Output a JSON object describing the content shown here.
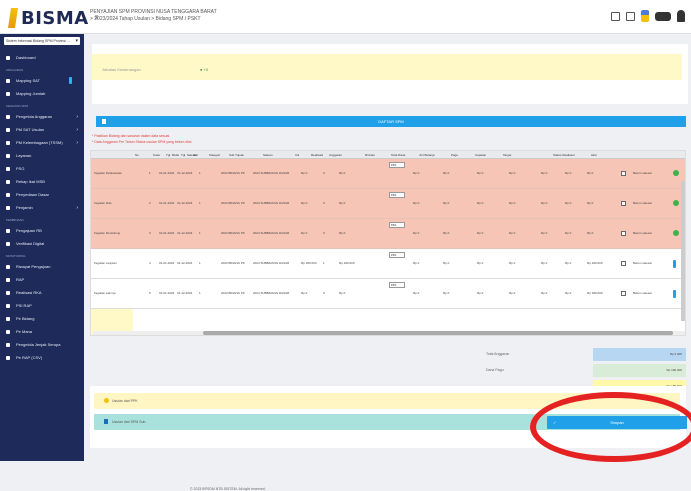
{
  "header": {
    "logo_text": "BISMA",
    "logo_sub": "≡",
    "title_line1": "PENYAJIAN SPM PROVINSI NUSA TENGGARA BARAT",
    "title_line2": "> 2023/2024 Tahap Usulan > Bidang SPM / PSKT"
  },
  "sidebar": {
    "select": "Sistem Informasi Bidang SPM Provinsi ...",
    "items": [
      {
        "label": "Dashboard",
        "group": ""
      },
      {
        "label": "Mapping SAT",
        "group": "ANGGARAN"
      },
      {
        "label": "Mapping Jumlah",
        "group": ""
      },
      {
        "label": "Pengelola Anggaran",
        "group": "KEGIATAN SPM"
      },
      {
        "label": "PM SAT Usulan",
        "group": ""
      },
      {
        "label": "PM Kelembagaan (TSSM)",
        "group": ""
      },
      {
        "label": "Layanan",
        "group": ""
      },
      {
        "label": "PSG",
        "group": ""
      },
      {
        "label": "Rekap Ikat MSB",
        "group": ""
      },
      {
        "label": "Penyediaan Dasar",
        "group": ""
      },
      {
        "label": "Penjamin",
        "group": ""
      },
      {
        "label": "Pengajuan RB",
        "group": "PEMBINAAN"
      },
      {
        "label": "Verifikasi Digital",
        "group": ""
      },
      {
        "label": "Riwayat Pengajuan",
        "group": "MONITORING"
      },
      {
        "label": "RAP",
        "group": ""
      },
      {
        "label": "Realisasi RKA",
        "group": ""
      },
      {
        "label": "PSI RAP",
        "group": ""
      },
      {
        "label": "Pe Bidang",
        "group": ""
      },
      {
        "label": "Pe Mana",
        "group": ""
      },
      {
        "label": "Pengelola Jenjak Serupa",
        "group": ""
      },
      {
        "label": "Pe RAP (CSV)",
        "group": ""
      }
    ]
  },
  "form": {
    "field_label": "Jabatan Kewenangan",
    "field_value": "● +0",
    "button_label": "DAFTAR SPM",
    "note1": "* Pastikan Bidang dan sasaran dalam data sesuai",
    "note2": "* Data Anggaran Per Tahun Status usulan SPM yang belum diisi"
  },
  "table": {
    "headers": [
      "No",
      "Kode",
      "Tgl. Mulai",
      "Tgl. Selesai",
      "Jml",
      "Kategori",
      "Sub Tujuan",
      "Satuan",
      "Vol",
      "Realisasi",
      "Anggaran",
      "Rincian",
      "Total Dana",
      "Jml Belanja",
      "Pagu",
      "Capaian",
      "Target",
      "Status Realisasi",
      "Aksi"
    ],
    "rows": [
      {
        "type": "red",
        "label": "Kegiatan Pelaksanaan",
        "n": "1",
        "start": "01-01-2024",
        "end": "31-12-2024",
        "qty": "1",
        "cat": "2023 BIDANG PK",
        "sub": "2024 SUBBIDANG DASAR",
        "unit": "Rp 0",
        "vol": "0",
        "real": "Rp 0",
        "sel": "Pilih",
        "anggaran": "Rp 0",
        "rincian": "Rp 0",
        "total": "Rp 0",
        "belanja": "Rp 0",
        "pagu": "Rp 0",
        "capaian": "Rp 0",
        "target": "Rp 0",
        "status": "Belum selesai"
      },
      {
        "type": "red",
        "label": "Kegiatan Fisik",
        "n": "2",
        "start": "01-01-2024",
        "end": "31-12-2024",
        "qty": "1",
        "cat": "2023 BIDANG PK",
        "sub": "2024 SUBBIDANG DASAR",
        "unit": "Rp 0",
        "vol": "0",
        "real": "Rp 0",
        "sel": "Pilih",
        "anggaran": "Rp 0",
        "rincian": "Rp 0",
        "total": "Rp 0",
        "belanja": "Rp 0",
        "pagu": "Rp 0",
        "capaian": "Rp 0",
        "target": "Rp 0",
        "status": "Belum selesai"
      },
      {
        "type": "red",
        "label": "Kegiatan Pendukung",
        "n": "3",
        "start": "01-01-2024",
        "end": "31-12-2024",
        "qty": "1",
        "cat": "2023 BIDANG PK",
        "sub": "2024 SUBBIDANG DASAR",
        "unit": "Rp 0",
        "vol": "0",
        "real": "Rp 0",
        "sel": "Pilih",
        "anggaran": "Rp 0",
        "rincian": "Rp 0",
        "total": "Rp 0",
        "belanja": "Rp 0",
        "pagu": "Rp 0",
        "capaian": "Rp 0",
        "target": "Rp 0",
        "status": "Belum selesai"
      },
      {
        "type": "white",
        "label": "Kegiatan Lanjutan",
        "n": "4",
        "start": "01-01-2024",
        "end": "31-12-2024",
        "qty": "1",
        "cat": "2023 BIDANG PK",
        "sub": "2024 SUBBIDANG DASAR",
        "unit": "Rp 180.000",
        "vol": "1",
        "real": "Rp 180.000",
        "sel": "Pilih",
        "anggaran": "Rp 0",
        "rincian": "Rp 0",
        "total": "Rp 0",
        "belanja": "Rp 0",
        "pagu": "Rp 0",
        "capaian": "Rp 0",
        "target": "Rp 180.000",
        "status": "Belum selesai"
      },
      {
        "type": "white",
        "label": "Kegiatan Lainnya",
        "n": "5",
        "start": "01-01-2024",
        "end": "31-12-2024",
        "qty": "1",
        "cat": "2023 BIDANG PK",
        "sub": "2024 SUBBIDANG DASAR",
        "unit": "Rp 0",
        "vol": "0",
        "real": "Rp 0",
        "sel": "Pilih",
        "anggaran": "Rp 0",
        "rincian": "Rp 0",
        "total": "Rp 0",
        "belanja": "Rp 0",
        "pagu": "Rp 0",
        "capaian": "Rp 0",
        "target": "Rp 180.000",
        "status": "Belum selesai"
      }
    ]
  },
  "totals": [
    {
      "label": "Total Anggaran",
      "value": "Rp 0.000",
      "color": "#b6d6f2"
    },
    {
      "label": "Dana Pagu",
      "value": "Rp 190.000",
      "color": "#d9ecd7"
    },
    {
      "label": "",
      "value": "Rp 180.000",
      "color": "#fff8a8"
    }
  ],
  "legend": {
    "yellow": "Usulan dari PPK",
    "teal": "Usulan dari SPM Sub"
  },
  "submit": {
    "label": "Simpan",
    "check": "✓"
  },
  "footer": {
    "link": "BPSDM NTB SISTEM",
    "text": "© 2023 BPSDM NTB SISTEM. All right reserved."
  },
  "colors": {
    "sidebar": "#1d2a5a",
    "accent": "#1fa0e8",
    "row_red": "#f6c5b5",
    "highlight": "#e52222"
  }
}
